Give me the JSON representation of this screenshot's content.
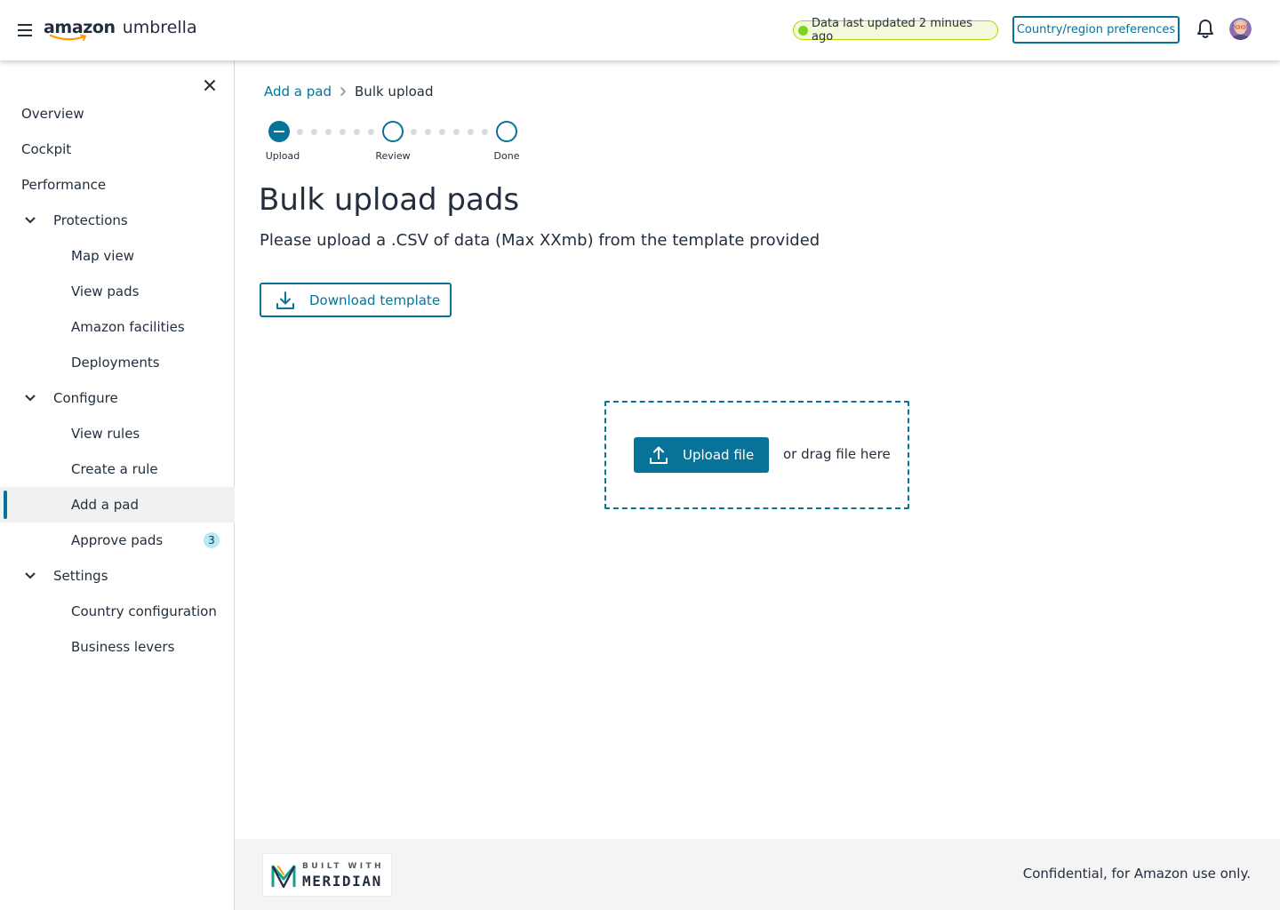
{
  "header": {
    "logo_brand": "amazon",
    "logo_product": "umbrella",
    "status_text": "Data last updated 2 minues ago",
    "country_button": "Country/region preferences",
    "icons": {
      "menu": "hamburger-menu-icon",
      "notifications": "bell-icon",
      "avatar": "user-avatar"
    },
    "colors": {
      "accent": "#077398",
      "status_dot": "#7ed321",
      "status_border": "#b3d300"
    }
  },
  "sidebar": {
    "close_icon": "close-icon",
    "items": [
      {
        "label": "Overview"
      },
      {
        "label": "Cockpit"
      },
      {
        "label": "Performance"
      },
      {
        "label": "Protections",
        "expanded": true
      },
      {
        "label": "Map view"
      },
      {
        "label": "View pads"
      },
      {
        "label": "Amazon facilities"
      },
      {
        "label": "Deployments"
      },
      {
        "label": "Configure",
        "expanded": true
      },
      {
        "label": "View rules"
      },
      {
        "label": "Create a rule"
      },
      {
        "label": "Add a pad",
        "active": true
      },
      {
        "label": "Approve pads",
        "badge": "3"
      },
      {
        "label": "Settings",
        "expanded": true
      },
      {
        "label": "Country configuration"
      },
      {
        "label": "Business levers"
      }
    ]
  },
  "breadcrumb": {
    "parent": "Add a pad",
    "current": "Bulk upload"
  },
  "stepper": {
    "steps": [
      {
        "label": "Upload",
        "state": "current"
      },
      {
        "label": "Review",
        "state": "todo"
      },
      {
        "label": "Done",
        "state": "todo"
      }
    ]
  },
  "main": {
    "title": "Bulk upload pads",
    "description": "Please upload a .CSV of data (Max XXmb) from the template provided",
    "download_button": "Download template",
    "upload_button": "Upload file",
    "drag_text": "or drag file here"
  },
  "footer": {
    "badge_top": "BUILT WITH",
    "badge_name": "MERIDIAN",
    "confidential": "Confidential, for Amazon use only."
  }
}
